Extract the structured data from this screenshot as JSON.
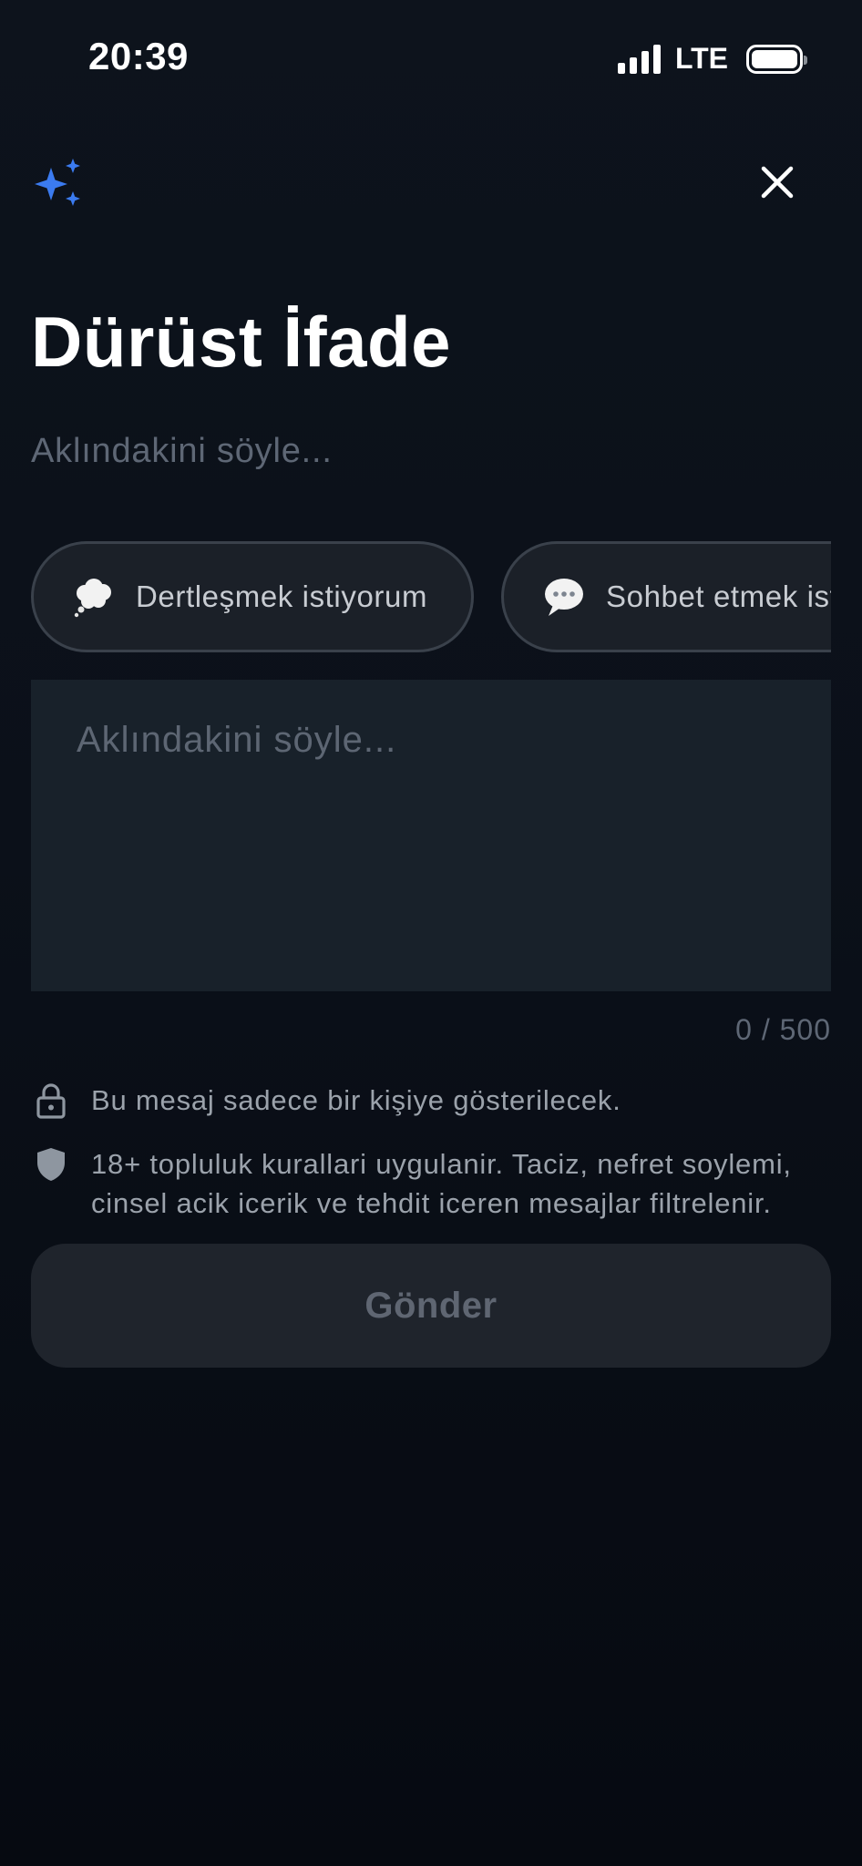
{
  "status_bar": {
    "time": "20:39",
    "network": "LTE"
  },
  "header": {
    "title": "Dürüst İfade",
    "subtitle": "Aklındakini söyle...",
    "accent_color": "#3b7bf0"
  },
  "chips": [
    {
      "emoji": "thought-bubble-icon",
      "label": "Dertleşmek istiyorum"
    },
    {
      "emoji": "speech-bubble-icon",
      "label": "Sohbet etmek istiyorum"
    }
  ],
  "message": {
    "value": "",
    "placeholder": "Aklındakini söyle...",
    "counter": "0 / 500"
  },
  "notices": {
    "privacy": "Bu mesaj sadece bir kişiye gösterilecek.",
    "rules": "18+ topluluk kurallari uygulanir. Taciz, nefret soylemi, cinsel acik icerik ve tehdit iceren mesajlar filtrelenir."
  },
  "actions": {
    "send_label": "Gönder"
  }
}
